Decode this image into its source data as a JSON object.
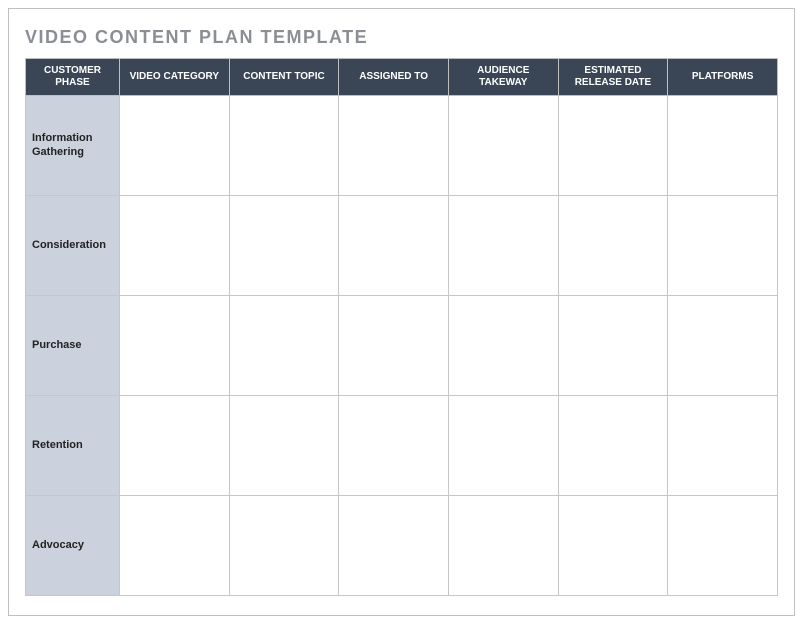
{
  "title": "VIDEO CONTENT PLAN TEMPLATE",
  "columns": [
    "CUSTOMER PHASE",
    "VIDEO CATEGORY",
    "CONTENT TOPIC",
    "ASSIGNED TO",
    "AUDIENCE TAKEWAY",
    "ESTIMATED RELEASE DATE",
    "PLATFORMS"
  ],
  "rows": [
    {
      "phase": "Information Gathering",
      "video_category": "",
      "content_topic": "",
      "assigned_to": "",
      "audience_takeaway": "",
      "estimated_release_date": "",
      "platforms": ""
    },
    {
      "phase": "Consideration",
      "video_category": "",
      "content_topic": "",
      "assigned_to": "",
      "audience_takeaway": "",
      "estimated_release_date": "",
      "platforms": ""
    },
    {
      "phase": "Purchase",
      "video_category": "",
      "content_topic": "",
      "assigned_to": "",
      "audience_takeaway": "",
      "estimated_release_date": "",
      "platforms": ""
    },
    {
      "phase": "Retention",
      "video_category": "",
      "content_topic": "",
      "assigned_to": "",
      "audience_takeaway": "",
      "estimated_release_date": "",
      "platforms": ""
    },
    {
      "phase": "Advocacy",
      "video_category": "",
      "content_topic": "",
      "assigned_to": "",
      "audience_takeaway": "",
      "estimated_release_date": "",
      "platforms": ""
    }
  ]
}
